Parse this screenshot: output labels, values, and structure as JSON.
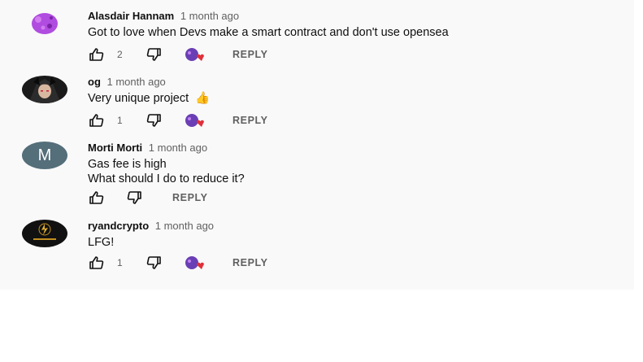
{
  "colors": {
    "background": "#f9f9f9",
    "muted": "#606060",
    "heart": "#e0303a",
    "creator_avatar": "#6a3fb5"
  },
  "comments": [
    {
      "author": "Alasdair Hannam",
      "time": "1 month ago",
      "lines": [
        "Got to love when Devs make a smart contract and don't use opensea"
      ],
      "likes": "2",
      "hearted": true,
      "avatar": "purple-blob-avatar",
      "reply_label": "REPLY"
    },
    {
      "author": "og",
      "time": "1 month ago",
      "lines": [
        "Very unique project"
      ],
      "emoji": "👍",
      "likes": "1",
      "hearted": true,
      "avatar": "anime-character-avatar",
      "reply_label": "REPLY"
    },
    {
      "author": "Morti Morti",
      "time": "1 month ago",
      "lines": [
        "Gas fee is high",
        "What should I do to reduce it?"
      ],
      "likes": "",
      "hearted": false,
      "avatar": "letter-avatar",
      "avatar_letter": "M",
      "reply_label": "REPLY"
    },
    {
      "author": "ryandcrypto",
      "time": "1 month ago",
      "lines": [
        "LFG!"
      ],
      "likes": "1",
      "hearted": true,
      "avatar": "crypto-logo-avatar",
      "reply_label": "REPLY"
    }
  ]
}
